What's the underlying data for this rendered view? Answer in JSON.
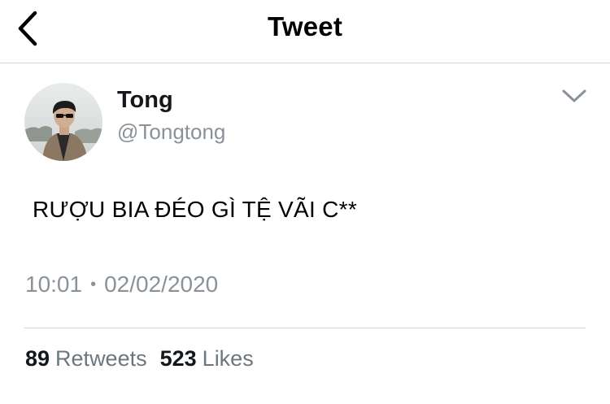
{
  "header": {
    "title": "Tweet",
    "back_icon": "chevron-left-icon"
  },
  "author": {
    "display_name": "Tong",
    "handle": "@Tongtong",
    "more_icon": "chevron-down-icon"
  },
  "tweet": {
    "text": "RƯỢU BIA ĐÉO GÌ TỆ VÃI C**",
    "time": "10:01",
    "separator": "•",
    "date": "02/02/2020"
  },
  "stats": {
    "retweets_count": "89",
    "retweets_label": "Retweets",
    "likes_count": "523",
    "likes_label": "Likes"
  },
  "colors": {
    "primary_text": "#14171a",
    "secondary_text": "#8a9299",
    "divider": "#d1d6da"
  }
}
